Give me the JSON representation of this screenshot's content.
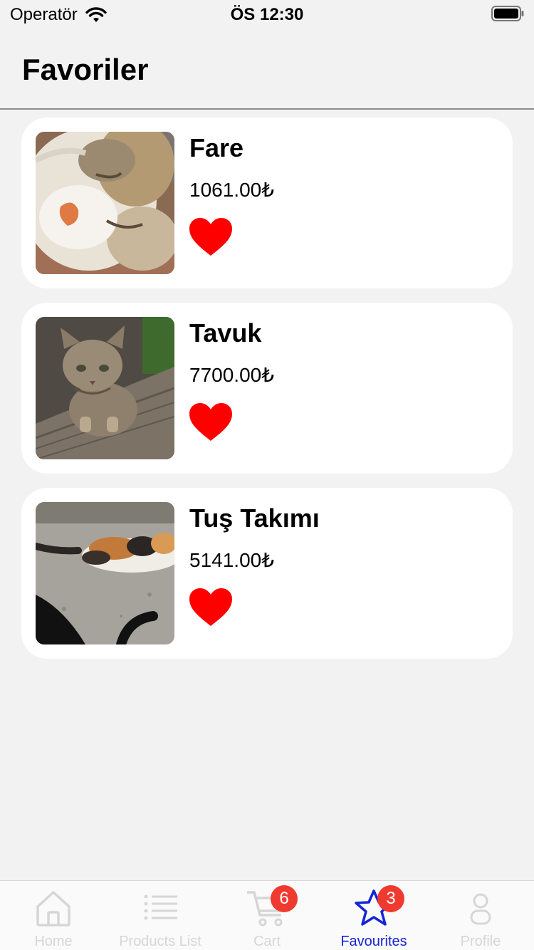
{
  "status_bar": {
    "carrier": "Operatör",
    "time": "ÖS 12:30"
  },
  "header": {
    "title": "Favoriler"
  },
  "favorites": [
    {
      "name": "Fare",
      "price": "1061.00₺",
      "favorited": true
    },
    {
      "name": "Tavuk",
      "price": "7700.00₺",
      "favorited": true
    },
    {
      "name": "Tuş Takımı",
      "price": "5141.00₺",
      "favorited": true
    }
  ],
  "tab_bar": {
    "tabs": [
      {
        "label": "Home",
        "icon": "home-icon"
      },
      {
        "label": "Products List",
        "icon": "list-icon"
      },
      {
        "label": "Cart",
        "icon": "cart-icon",
        "badge": "6"
      },
      {
        "label": "Favourites",
        "icon": "star-icon",
        "badge": "3",
        "active": true
      },
      {
        "label": "Profile",
        "icon": "profile-icon"
      }
    ]
  },
  "colors": {
    "accent": "#1525d6",
    "heart": "#ff0000",
    "badge": "#f03a2f",
    "background": "#f2f2f2"
  }
}
